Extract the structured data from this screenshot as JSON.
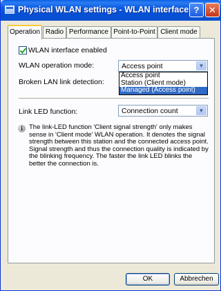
{
  "window": {
    "title": "Physical WLAN settings - WLAN interface",
    "help_glyph": "?",
    "close_glyph": "✕",
    "icon": "network-window-icon"
  },
  "tabs": [
    {
      "label": "Operation",
      "active": true
    },
    {
      "label": "Radio",
      "active": false
    },
    {
      "label": "Performance",
      "active": false
    },
    {
      "label": "Point-to-Point",
      "active": false
    },
    {
      "label": "Client mode",
      "active": false
    }
  ],
  "operation": {
    "wlan_enabled_label": "WLAN interface enabled",
    "wlan_enabled_checked": true,
    "mode_label": "WLAN operation mode:",
    "mode_value": "Access point",
    "mode_options": [
      "Access point",
      "Station (Client mode)",
      "Managed (Access point)"
    ],
    "mode_highlighted": "Managed (Access point)",
    "broken_link_label": "Broken LAN link detection:",
    "led_label": "Link LED function:",
    "led_value": "Connection count",
    "info_icon": "info-icon",
    "info_text": "The link-LED function 'Client signal strength' only makes sense in 'Client mode' WLAN operation. It denotes the signal strength between this station and the connected access point. Signal strength and thus the connection quality is indicated by the blinking frequency. The faster the link LED blinks the better the connection is."
  },
  "buttons": {
    "ok": "OK",
    "cancel": "Abbrechen"
  },
  "colors": {
    "titlebar": "#0b5ae0",
    "selection": "#316ac5",
    "active_tab_accent": "#ffc83c",
    "dialog_bg": "#ece9d8"
  }
}
